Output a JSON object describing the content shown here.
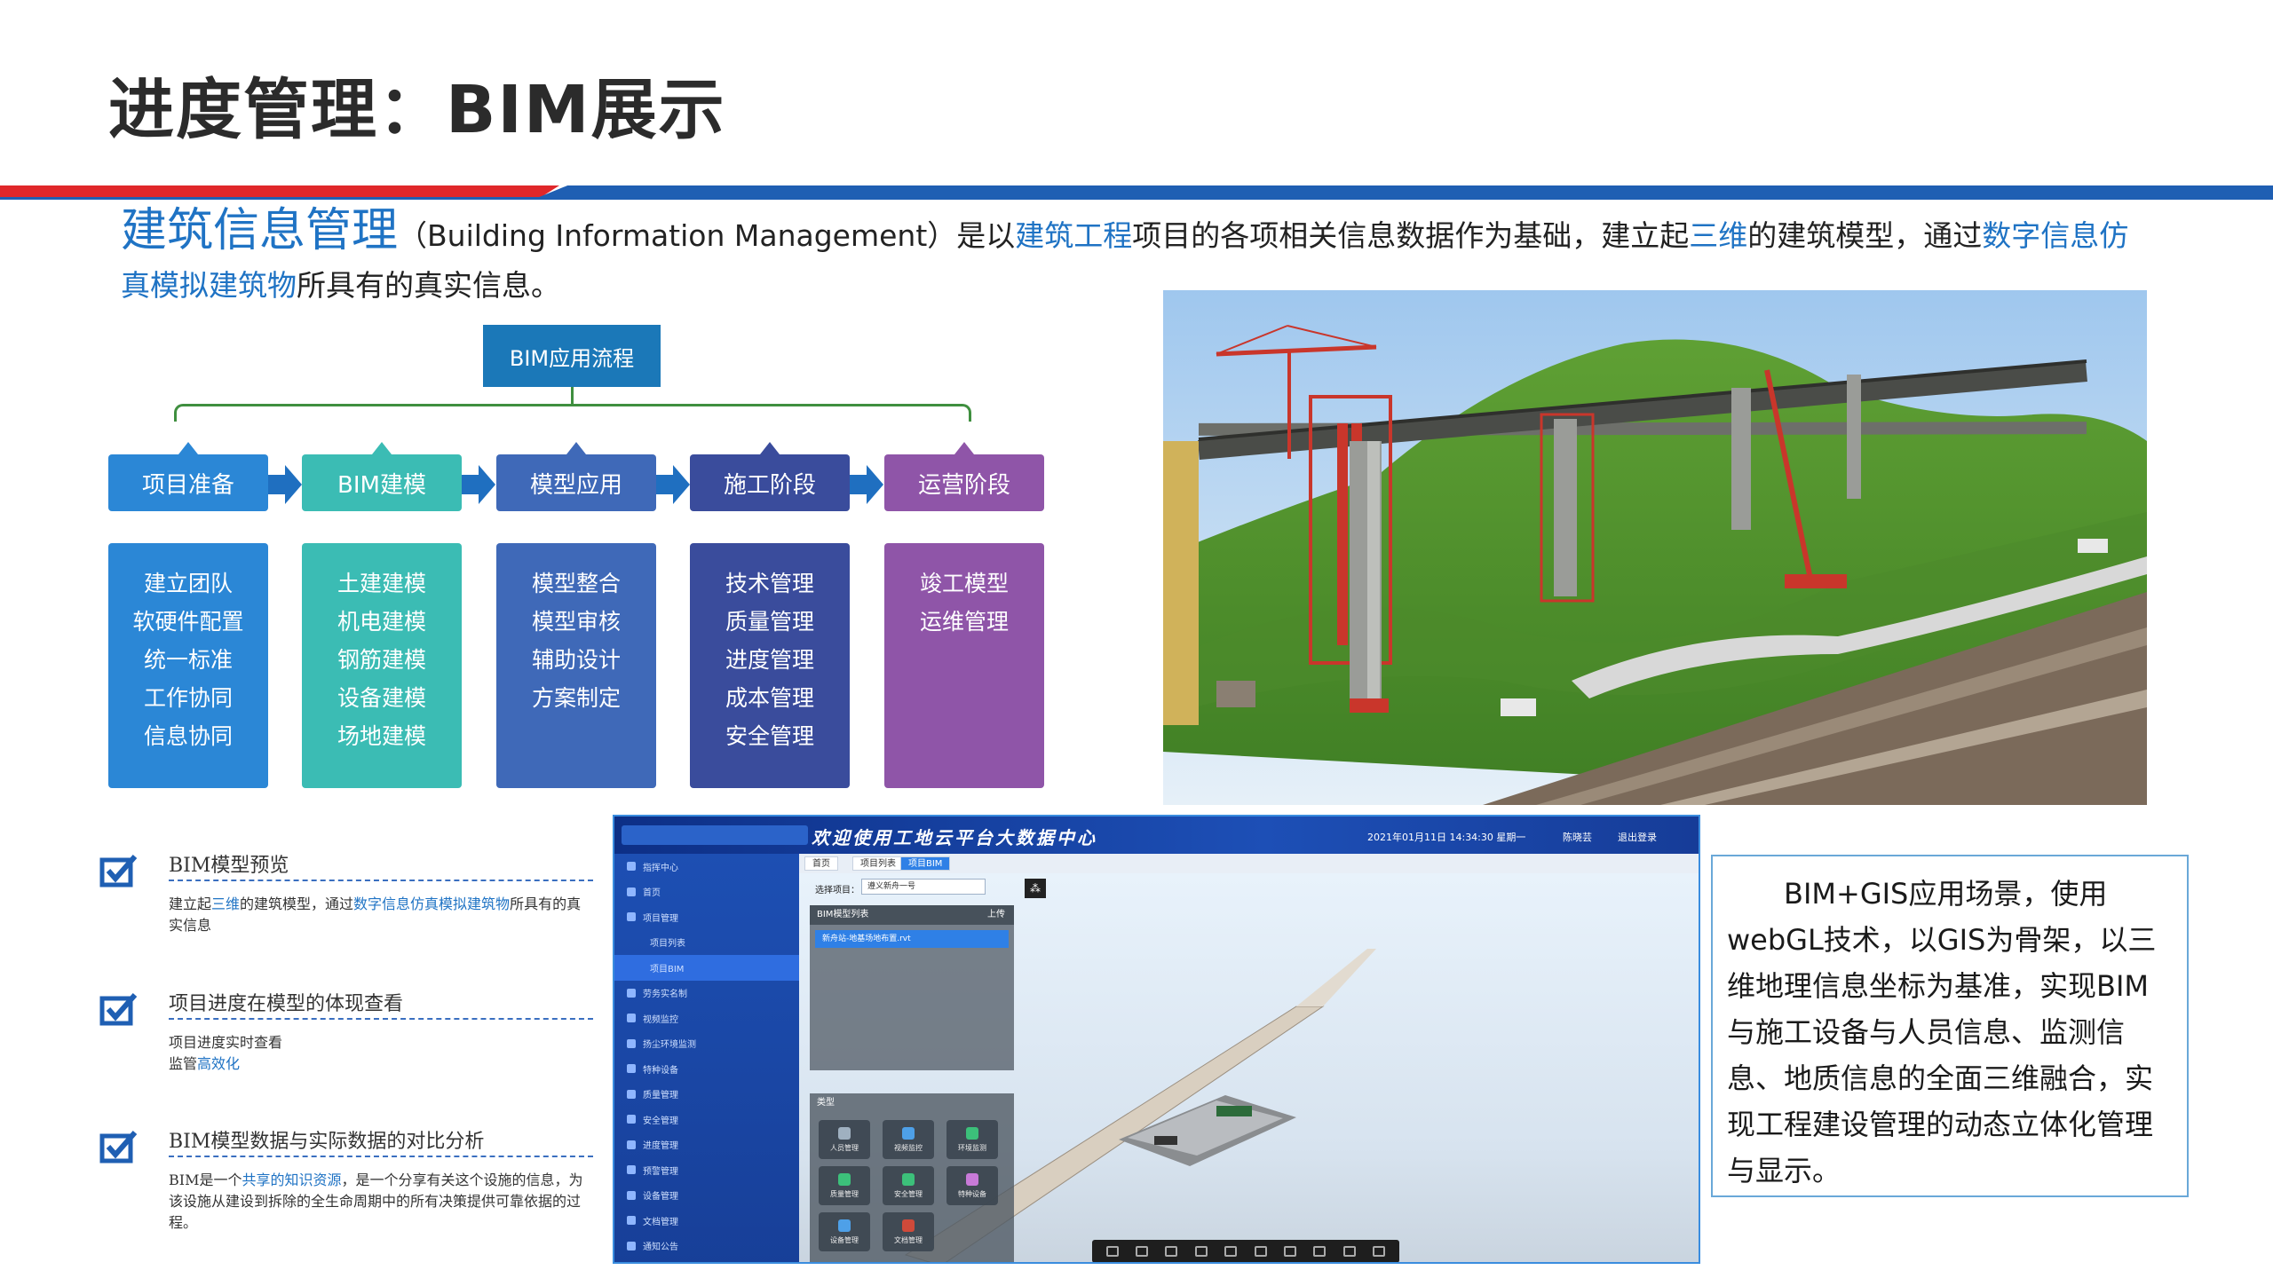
{
  "slide": {
    "title": "进度管理：BIM展示"
  },
  "intro": {
    "term": "建筑信息管理",
    "part1": "（Building Information Management）是以",
    "hl1": "建筑工程",
    "part2": "项目的各项相关信息数据作为基础，建立起",
    "hl2": "三维",
    "part3": "的建筑模型，通过",
    "hl3": "数字信息仿真模拟建筑物",
    "part4": "所具有的真实信息。"
  },
  "flow": {
    "root": "BIM应用流程",
    "colors": [
      "#2b87d6",
      "#3bbcb4",
      "#3f69b8",
      "#3a4c9c",
      "#8f55a8"
    ],
    "phases": [
      {
        "label": "项目准备",
        "items": [
          "建立团队",
          "软硬件配置",
          "统一标准",
          "工作协同",
          "信息协同"
        ]
      },
      {
        "label": "BIM建模",
        "items": [
          "土建建模",
          "机电建模",
          "钢筋建模",
          "设备建模",
          "场地建模"
        ]
      },
      {
        "label": "模型应用",
        "items": [
          "模型整合",
          "模型审核",
          "辅助设计",
          "方案制定"
        ]
      },
      {
        "label": "施工阶段",
        "items": [
          "技术管理",
          "质量管理",
          "进度管理",
          "成本管理",
          "安全管理"
        ]
      },
      {
        "label": "运营阶段",
        "items": [
          "竣工模型",
          "运维管理"
        ]
      }
    ]
  },
  "checklist": [
    {
      "title": "BIM模型预览",
      "desc_a": "建立起",
      "desc_hl": "三维",
      "desc_b": "的建筑模型，通过",
      "desc_hl2": "数字信息仿真模拟建筑物",
      "desc_c": "所具有的真实信息"
    },
    {
      "title": "项目进度在模型的体现查看",
      "desc_a": "项目进度实时查看",
      "desc_b": "监管",
      "desc_hl": "高效化"
    },
    {
      "title": "BIM模型数据与实际数据的对比分析",
      "desc_a": "BIM是一个",
      "desc_hl": "共享的知识资源",
      "desc_b": "，是一个分享有关这个设施的信息，为该设施从建设到拆除的全生命周期中的所有决策提供可靠依据的过程。"
    }
  ],
  "platform": {
    "heading": "欢迎使用工地云平台大数据中心",
    "datetime": "2021年01月11日 14:34:30 星期一",
    "user": "陈晓芸",
    "logout": "退出登录",
    "sidebar": [
      "指挥中心",
      "首页",
      "项目管理",
      "项目列表",
      "项目BIM",
      "劳务实名制",
      "视频监控",
      "扬尘环境监测",
      "特种设备",
      "质量管理",
      "安全管理",
      "进度管理",
      "预警管理",
      "设备管理",
      "文档管理",
      "通知公告"
    ],
    "tabs": [
      "首页",
      "项目列表",
      "项目BIM"
    ],
    "select_label": "选择项目：",
    "select_value": "遵义新舟一号",
    "list_title": "BIM模型列表",
    "list_action": "上传",
    "list_row": "新舟站-地基场地布置.rvt",
    "type_title": "类型",
    "type_buttons": [
      "人员管理",
      "视频监控",
      "环境监测",
      "质量管理",
      "安全管理",
      "特种设备",
      "设备管理",
      "文档管理"
    ]
  },
  "gis_text": "BIM+GIS应用场景，使用webGL技术，以GIS为骨架，以三维地理信息坐标为基准，实现BIM与施工设备与人员信息、监测信息、地质信息的全面三维融合，实现工程建设管理的动态立体化管理与显示。"
}
